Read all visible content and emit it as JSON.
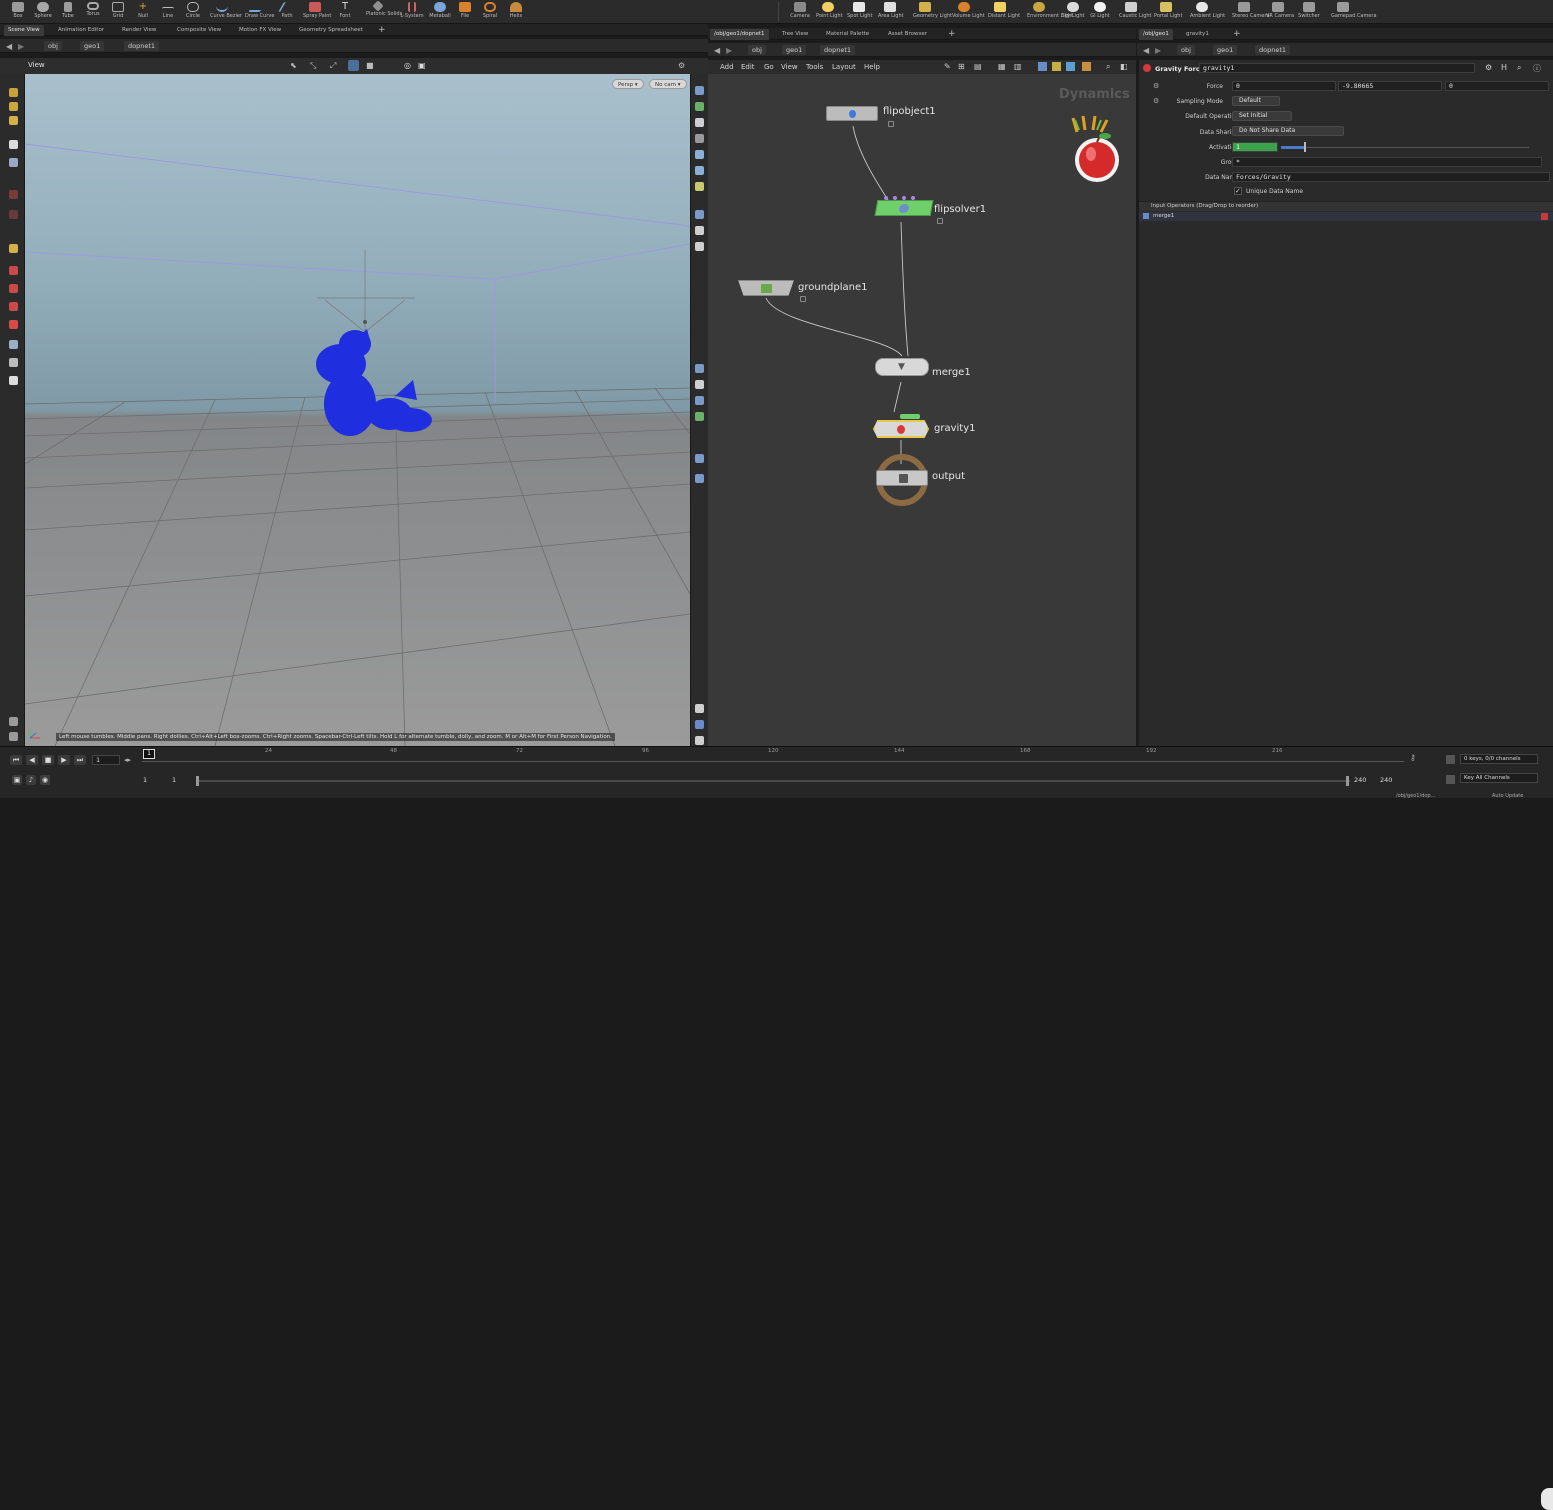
{
  "shelf": {
    "left_tools": [
      "Box",
      "Sphere",
      "Tube",
      "Torus",
      "Grid",
      "Null",
      "Line",
      "Circle",
      "Curve Bezier",
      "Draw Curve",
      "Path",
      "Spray Paint",
      "Font",
      "Platonic Solids",
      "L-System",
      "Metaball",
      "File",
      "Spiral",
      "Helix"
    ],
    "right_tools": [
      "Camera",
      "Point Light",
      "Spot Light",
      "Area Light",
      "Geometry Light",
      "Volume Light",
      "Distant Light",
      "Environment Light",
      "Sky Light",
      "GI Light",
      "Caustic Light",
      "Portal Light",
      "Ambient Light",
      "Stereo Camera",
      "VR Camera",
      "Switcher",
      "Gamepad Camera"
    ]
  },
  "left_pane": {
    "tabs": [
      "Scene View",
      "Animation Editor",
      "Render View",
      "Composite View",
      "Motion FX View",
      "Geometry Spreadsheet"
    ],
    "path": [
      "obj",
      "geo1",
      "dopnet1"
    ],
    "view_label": "View",
    "persp": "Persp ▾",
    "cam": "No cam ▾",
    "hint": "Left mouse tumbles. Middle pans. Right dollies. Ctrl+Alt+Left box-zooms. Ctrl+Right zooms. Spacebar-Ctrl-Left tilts. Hold L for alternate tumble, dolly, and zoom.    M or Alt+M for First Person Navigation."
  },
  "mid_pane": {
    "tabs": [
      "/obj/geo1/dopnet1",
      "Tree View",
      "Material Palette",
      "Asset Browser"
    ],
    "path": [
      "obj",
      "geo1",
      "dopnet1"
    ],
    "menus": [
      "Add",
      "Edit",
      "Go",
      "View",
      "Tools",
      "Layout",
      "Help"
    ],
    "context_label": "Dynamics",
    "nodes": [
      {
        "name": "flipobject1"
      },
      {
        "name": "flipsolver1"
      },
      {
        "name": "groundplane1"
      },
      {
        "name": "merge1"
      },
      {
        "name": "gravity1"
      },
      {
        "name": "output"
      }
    ]
  },
  "params": {
    "tabs": [
      "/obj/geo1",
      "gravity1"
    ],
    "path": [
      "obj",
      "geo1",
      "dopnet1"
    ],
    "node_type": "Gravity Force",
    "node_name": "gravity1",
    "force_label": "Force",
    "force": [
      "0",
      "-9.80665",
      "0"
    ],
    "sampling_label": "Sampling Mode",
    "sampling": "Default",
    "default_op_label": "Default Operation",
    "default_op": "Set Initial",
    "data_sharing_label": "Data Sharing",
    "data_sharing": "Do Not Share Data",
    "activation_label": "Activation",
    "activation": "1",
    "group_label": "Group",
    "group": "*",
    "data_name_label": "Data Name",
    "data_name": "Forces/Gravity",
    "unique_label": "Unique Data Name",
    "inputs_header": "Input Operators (Drag/Drop to reorder)",
    "input_item": "merge1"
  },
  "timeline": {
    "ticks": [
      "24",
      "48",
      "72",
      "96",
      "120",
      "144",
      "168",
      "192",
      "216"
    ],
    "current_frame": "1",
    "start": "1",
    "start2": "1",
    "end": "240",
    "end2": "240",
    "keys": "0 keys, 0/0 channels",
    "key_all": "Key All Channels",
    "path": "/obj/geo1/dop...",
    "auto_update": "Auto Update"
  }
}
